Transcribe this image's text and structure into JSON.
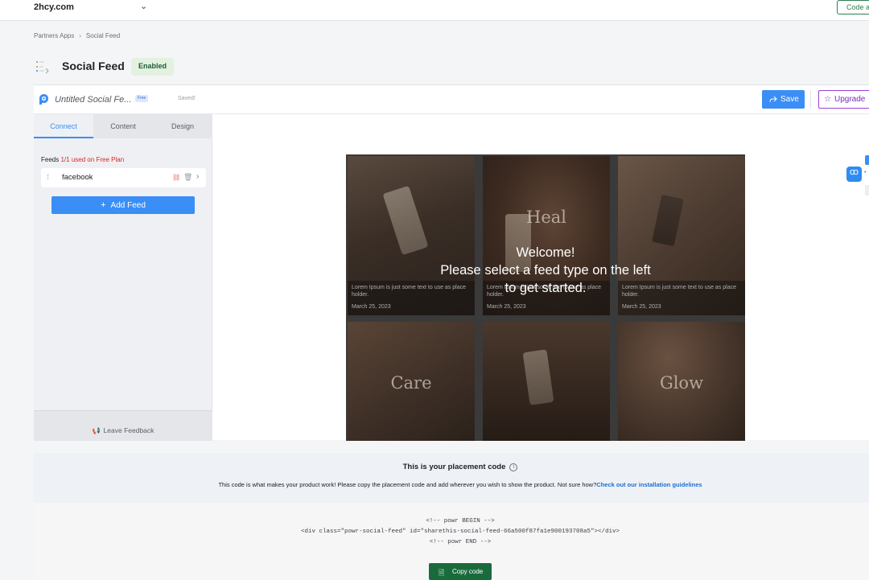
{
  "topbar": {
    "store_name": "2hcy.com",
    "code_access_label": "Code ac"
  },
  "breadcrumb": {
    "parent": "Partners Apps",
    "separator": "›",
    "current": "Social Feed"
  },
  "page": {
    "title": "Social Feed",
    "status": "Enabled"
  },
  "editor": {
    "feed_name": "Untitled Social Fe...",
    "plan": "Free",
    "saved_status": "Saved!",
    "save_label": "Save",
    "upgrade_label": "Upgrade"
  },
  "sidebar": {
    "tabs": [
      {
        "label": "Connect",
        "active": true
      },
      {
        "label": "Content",
        "active": false
      },
      {
        "label": "Design",
        "active": false
      }
    ],
    "feeds_label": "Feeds",
    "feeds_usage": "1/1 used on Free Plan",
    "feed_item": "facebook",
    "add_feed_label": "Add Feed",
    "feedback_label": "Leave Feedback"
  },
  "preview": {
    "overlay_line1": "Welcome!",
    "overlay_line2": "Please select a feed type on the left",
    "overlay_line3": "to get started.",
    "tiles": [
      {
        "word": "",
        "caption": "Lorem Ipsum is just some text to use as place holder.",
        "date": "March 25, 2023"
      },
      {
        "word": "Heal",
        "caption": "Lorem Ipsum is just some text to use as place holder.",
        "date": "March 25, 2023"
      },
      {
        "word": "",
        "caption": "Lorem Ipsum is just some text to use as place holder.",
        "date": "March 25, 2023"
      },
      {
        "word": "Care",
        "caption": "",
        "date": ""
      },
      {
        "word": "",
        "caption": "",
        "date": ""
      },
      {
        "word": "Glow",
        "caption": "",
        "date": ""
      }
    ]
  },
  "placement": {
    "title": "This is your placement code",
    "description": "This code is what makes your product work! Please copy the placement code and add wherever you wish to show the product. Not sure how?",
    "link": "Check out our installation guidelines",
    "code_line1": "<!-- powr BEGIN -->",
    "code_line2": "<div class=\"powr-social-feed\" id=\"sharethis-social-feed-66a500f87fa1e900193708a5\"></div>",
    "code_line3": "<!-- powr END -->",
    "copy_label": "Copy code"
  },
  "colors": {
    "primary_blue": "#3a8ef6",
    "success_green": "#1a6b3c",
    "upgrade_purple": "#9a3fd9",
    "error_red": "#e02424"
  },
  "icons": [
    "chevron-down-icon",
    "app-icon",
    "powr-logo-icon",
    "share-icon",
    "star-icon",
    "drag-handle-icon",
    "unlink-icon",
    "trash-icon",
    "chevron-right-icon",
    "plus-icon",
    "megaphone-icon",
    "info-icon",
    "document-icon",
    "widget-icon"
  ]
}
